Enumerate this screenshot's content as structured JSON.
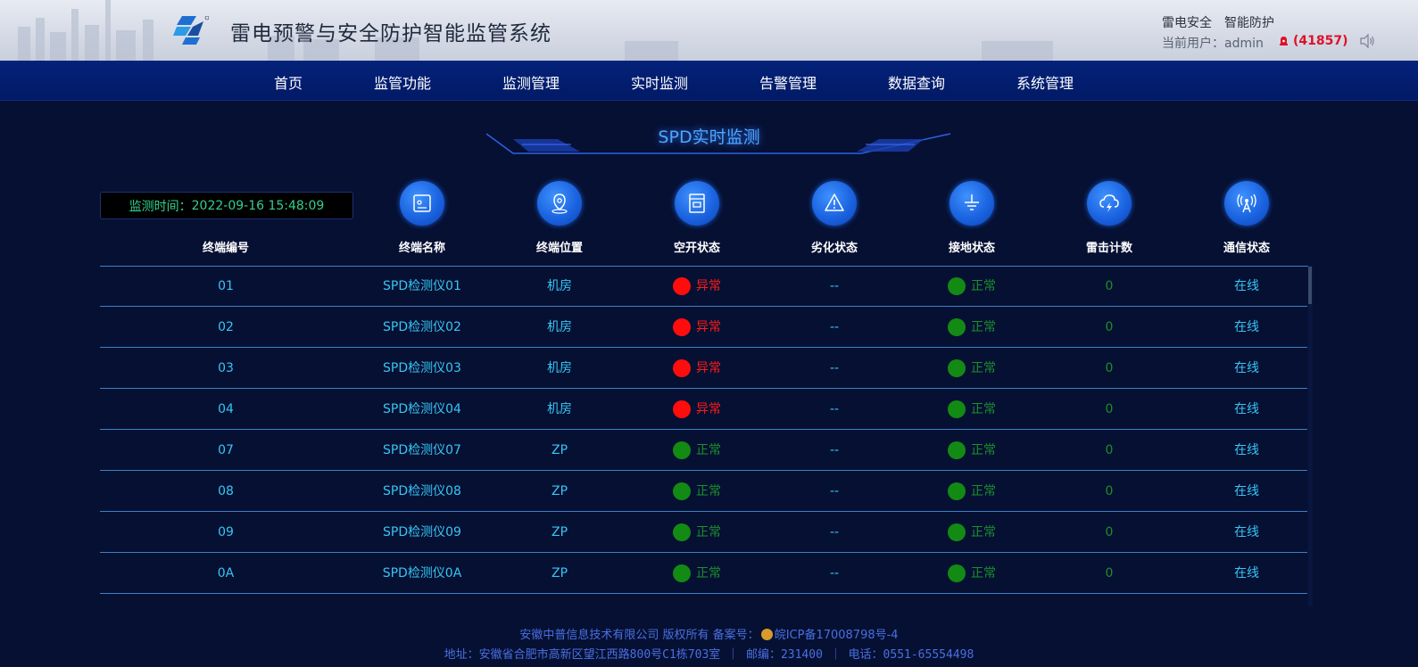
{
  "header": {
    "title": "雷电预警与安全防护智能监管系统",
    "slogan": [
      "雷电安全",
      "智能防护"
    ],
    "user_label": "当前用户：",
    "user_name": "admin",
    "alarm_count": "(41857)"
  },
  "nav": {
    "items": [
      "首页",
      "监管功能",
      "监测管理",
      "实时监测",
      "告警管理",
      "数据查询",
      "系统管理"
    ]
  },
  "section": {
    "title": "SPD实时监测"
  },
  "monitor": {
    "time_label": "监测时间：",
    "time_value": "2022-09-16 15:48:09"
  },
  "columns": {
    "id": "终端编号",
    "name": "终端名称",
    "location": "终端位置",
    "breaker": "空开状态",
    "degradation": "劣化状态",
    "grounding": "接地状态",
    "strikes": "雷击计数",
    "comm": "通信状态"
  },
  "colors": {
    "normal": "#138a13",
    "abnormal": "#ff0d0d",
    "accent": "#36c6f4"
  },
  "rows": [
    {
      "id": "01",
      "name": "SPD检测仪01",
      "location": "机房",
      "breaker": "异常",
      "breaker_state": "abnormal",
      "degradation": "--",
      "grounding": "正常",
      "grounding_state": "normal",
      "strikes": "0",
      "comm": "在线"
    },
    {
      "id": "02",
      "name": "SPD检测仪02",
      "location": "机房",
      "breaker": "异常",
      "breaker_state": "abnormal",
      "degradation": "--",
      "grounding": "正常",
      "grounding_state": "normal",
      "strikes": "0",
      "comm": "在线"
    },
    {
      "id": "03",
      "name": "SPD检测仪03",
      "location": "机房",
      "breaker": "异常",
      "breaker_state": "abnormal",
      "degradation": "--",
      "grounding": "正常",
      "grounding_state": "normal",
      "strikes": "0",
      "comm": "在线"
    },
    {
      "id": "04",
      "name": "SPD检测仪04",
      "location": "机房",
      "breaker": "异常",
      "breaker_state": "abnormal",
      "degradation": "--",
      "grounding": "正常",
      "grounding_state": "normal",
      "strikes": "0",
      "comm": "在线"
    },
    {
      "id": "07",
      "name": "SPD检测仪07",
      "location": "ZP",
      "breaker": "正常",
      "breaker_state": "normal",
      "degradation": "--",
      "grounding": "正常",
      "grounding_state": "normal",
      "strikes": "0",
      "comm": "在线"
    },
    {
      "id": "08",
      "name": "SPD检测仪08",
      "location": "ZP",
      "breaker": "正常",
      "breaker_state": "normal",
      "degradation": "--",
      "grounding": "正常",
      "grounding_state": "normal",
      "strikes": "0",
      "comm": "在线"
    },
    {
      "id": "09",
      "name": "SPD检测仪09",
      "location": "ZP",
      "breaker": "正常",
      "breaker_state": "normal",
      "degradation": "--",
      "grounding": "正常",
      "grounding_state": "normal",
      "strikes": "0",
      "comm": "在线"
    },
    {
      "id": "0A",
      "name": "SPD检测仪0A",
      "location": "ZP",
      "breaker": "正常",
      "breaker_state": "normal",
      "degradation": "--",
      "grounding": "正常",
      "grounding_state": "normal",
      "strikes": "0",
      "comm": "在线"
    }
  ],
  "footer": {
    "line1_prefix": "安徽中普信息技术有限公司 版权所有 备案号：",
    "line1_icp": "皖ICP备17008798号-4",
    "line2": "地址：安徽省合肥市高新区望江西路800号C1栋703室 ｜ 邮编：231400 ｜ 电话：0551-65554498"
  }
}
